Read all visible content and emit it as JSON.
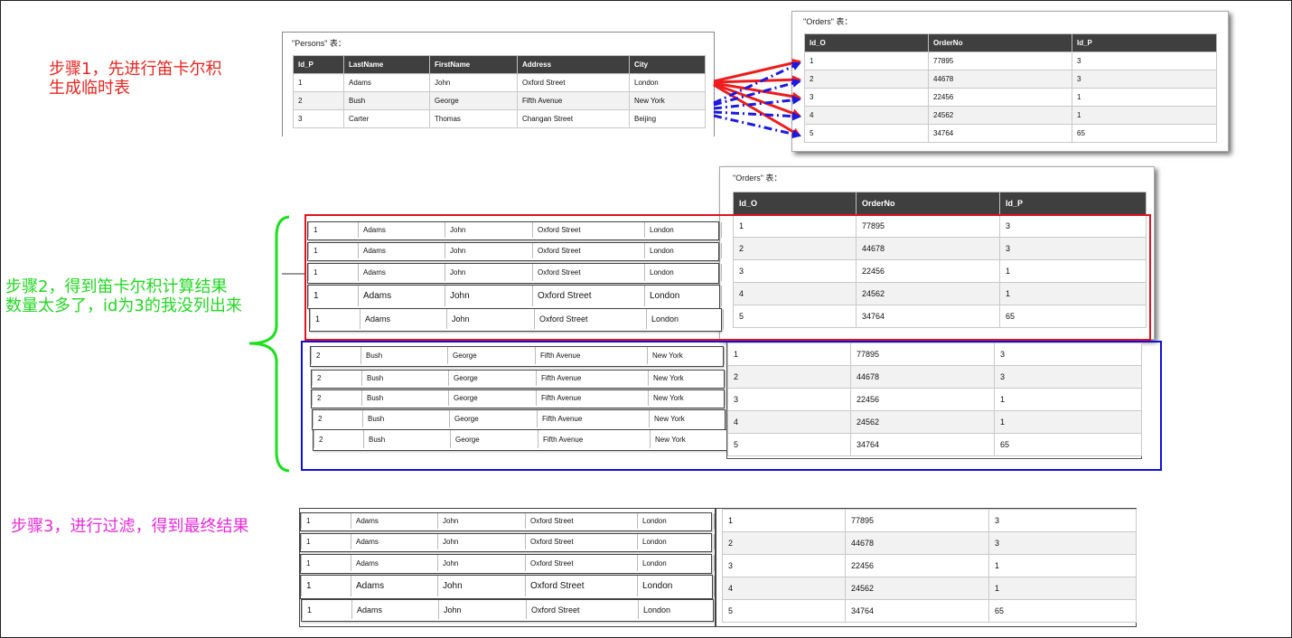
{
  "steps": {
    "step1": [
      "步骤1，先进行笛卡尔积",
      "生成临时表"
    ],
    "step2": [
      "步骤2，得到笛卡尔积计算结果",
      "数量太多了，id为3的我没列出来"
    ],
    "step3": "步骤3，进行过滤，得到最终结果"
  },
  "persons": {
    "caption": "\"Persons\" 表：",
    "headers": [
      "Id_P",
      "LastName",
      "FirstName",
      "Address",
      "City"
    ],
    "rows": [
      [
        "1",
        "Adams",
        "John",
        "Oxford Street",
        "London"
      ],
      [
        "2",
        "Bush",
        "George",
        "Fifth Avenue",
        "New York"
      ],
      [
        "3",
        "Carter",
        "Thomas",
        "Changan Street",
        "Beijing"
      ]
    ]
  },
  "orders": {
    "caption": "\"Orders\" 表：",
    "headers": [
      "Id_O",
      "OrderNo",
      "Id_P"
    ],
    "rows": [
      [
        "1",
        "77895",
        "3"
      ],
      [
        "2",
        "44678",
        "3"
      ],
      [
        "3",
        "22456",
        "1"
      ],
      [
        "4",
        "24562",
        "1"
      ],
      [
        "5",
        "34764",
        "65"
      ]
    ]
  },
  "colors": {
    "step1_text": "#e8251f",
    "step2_text": "#22d722",
    "step3_text": "#e62ad8",
    "red_box": "#e0141c",
    "blue_box": "#1010d8",
    "brace": "#1be01b",
    "red_arrow": "#ee1c1c",
    "blue_arrow": "#1a1ae0"
  }
}
